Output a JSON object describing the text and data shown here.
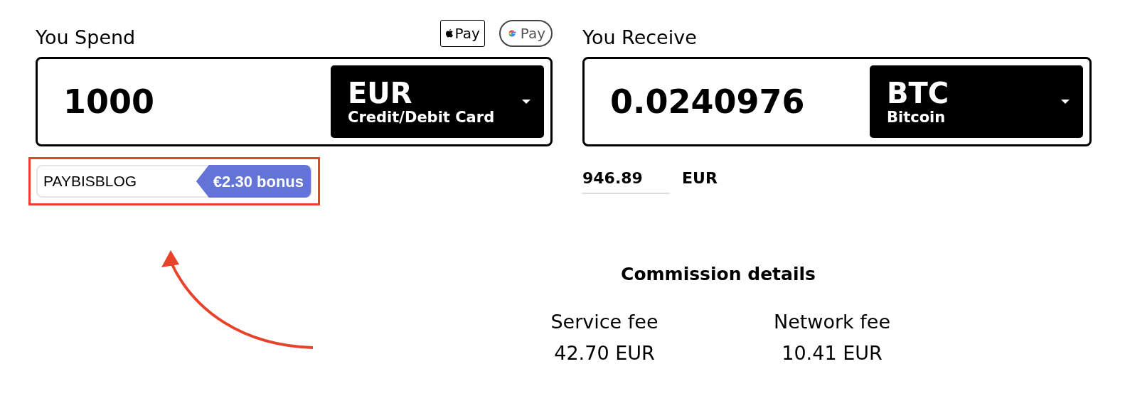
{
  "spend": {
    "label": "You Spend",
    "pay_badges": [
      {
        "kind": "apple",
        "text": "Pay"
      },
      {
        "kind": "google",
        "text": "Pay"
      }
    ],
    "amount": "1000",
    "currency": {
      "code": "EUR",
      "name": "Credit/Debit Card"
    },
    "promo": {
      "code": "PAYBISBLOG",
      "bonus": "€2.30 bonus"
    }
  },
  "receive": {
    "label": "You Receive",
    "amount": "0.0240976",
    "currency": {
      "code": "BTC",
      "name": "Bitcoin"
    },
    "rate": {
      "value": "946.89",
      "unit": "EUR"
    }
  },
  "commission": {
    "title": "Commission details",
    "fees": [
      {
        "label": "Service fee",
        "value": "42.70 EUR"
      },
      {
        "label": "Network fee",
        "value": "10.41 EUR"
      }
    ]
  }
}
